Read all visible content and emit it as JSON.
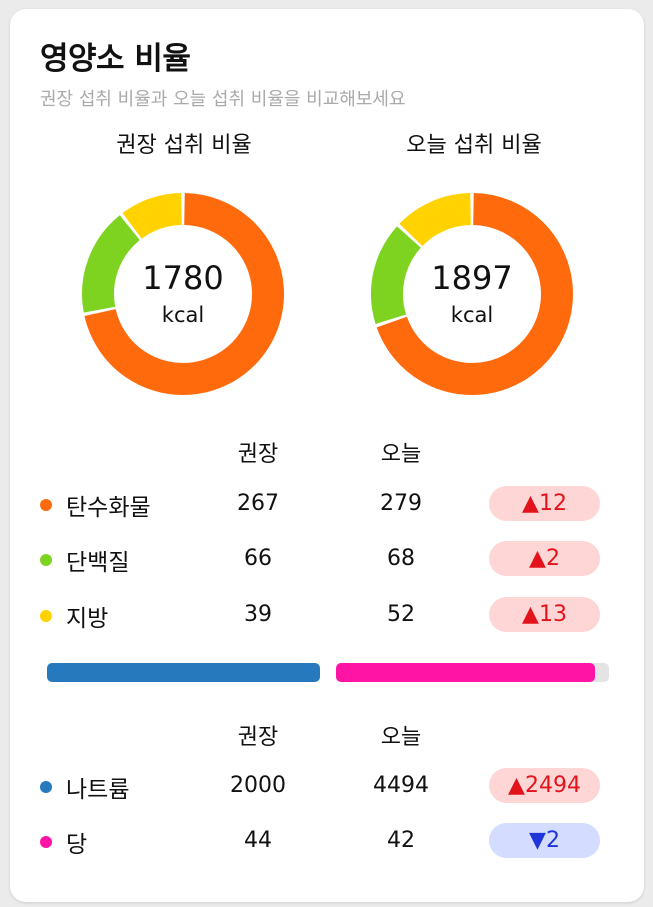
{
  "header": {
    "title": "영양소 비율",
    "subtitle": "권장 섭취 비율과 오늘 섭취 비율을 비교해보세요"
  },
  "charts": [
    {
      "caption": "권장 섭취 비율",
      "value": "1780",
      "unit": "kcal"
    },
    {
      "caption": "오늘 섭취 비율",
      "value": "1897",
      "unit": "kcal"
    }
  ],
  "chart_data": [
    {
      "type": "pie",
      "categories": [
        "탄수화물",
        "단백질",
        "지방"
      ],
      "values": [
        267,
        66,
        39
      ],
      "colors": [
        "#ff6a0d",
        "#7ed321",
        "#ffd200"
      ]
    },
    {
      "type": "pie",
      "categories": [
        "탄수화물",
        "단백질",
        "지방"
      ],
      "values": [
        279,
        68,
        52
      ],
      "colors": [
        "#ff6a0d",
        "#7ed321",
        "#ffd200"
      ]
    }
  ],
  "macro_table": {
    "col_recommended": "권장",
    "col_today": "오늘",
    "rows": [
      {
        "label": "탄수화물",
        "recommended": "267",
        "today": "279",
        "diff": "12",
        "dir": "up",
        "arrow": "▲",
        "color": "#ff6a0d"
      },
      {
        "label": "단백질",
        "recommended": "66",
        "today": "68",
        "diff": "2",
        "dir": "up",
        "arrow": "▲",
        "color": "#7ed321"
      },
      {
        "label": "지방",
        "recommended": "39",
        "today": "52",
        "diff": "13",
        "dir": "up",
        "arrow": "▲",
        "color": "#ffd200"
      }
    ]
  },
  "ratio_bar": {
    "sodium_color": "#2679bd",
    "sugar_color": "#ff14a6",
    "sugar_fill": 0.95
  },
  "micro_table": {
    "col_recommended": "권장",
    "col_today": "오늘",
    "rows": [
      {
        "label": "나트륨",
        "recommended": "2000",
        "today": "4494",
        "diff": "2494",
        "dir": "up",
        "arrow": "▲",
        "color": "#2679bd"
      },
      {
        "label": "당",
        "recommended": "44",
        "today": "42",
        "diff": "2",
        "dir": "down",
        "arrow": "▼",
        "color": "#ff14a6"
      }
    ]
  }
}
